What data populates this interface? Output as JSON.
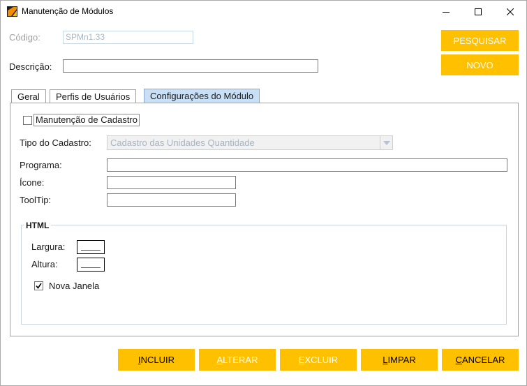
{
  "window": {
    "title": "Manutenção de Módulos",
    "accent_color": "#ffc000",
    "icon": "app-logo-icon"
  },
  "header": {
    "codigo_label": "Código:",
    "codigo_value": "SPMn1.33",
    "descricao_label": "Descrição:",
    "descricao_value": "",
    "pesquisar_label": "PESQUISAR",
    "novo_label": "NOVO"
  },
  "tabs": [
    {
      "label": "Geral",
      "active": false
    },
    {
      "label": "Perfis de Usuários",
      "active": false
    },
    {
      "label": "Configurações do Módulo",
      "active": true
    }
  ],
  "config": {
    "manutencao_label": "Manutenção de Cadastro",
    "manutencao_checked": false,
    "tipo_label": "Tipo do Cadastro:",
    "tipo_value": "Cadastro das Unidades Quantidade",
    "programa_label": "Programa:",
    "programa_value": "",
    "icone_label": "Ícone:",
    "icone_value": "",
    "tooltip_label": "ToolTip:",
    "tooltip_value": "",
    "html_group_title": "HTML",
    "largura_label": "Largura:",
    "altura_label": "Altura:",
    "nova_janela_label": "Nova Janela",
    "nova_janela_checked": true
  },
  "actions": {
    "incluir": {
      "first": "I",
      "rest": "NCLUIR",
      "enabled": true
    },
    "alterar": {
      "first": "A",
      "rest": "LTERAR",
      "enabled": false
    },
    "excluir": {
      "first": "E",
      "rest": "XCLUIR",
      "enabled": false
    },
    "limpar": {
      "first": "L",
      "rest": "IMPAR",
      "enabled": true
    },
    "cancelar": {
      "first": "C",
      "rest": "ANCELAR",
      "enabled": true
    }
  }
}
